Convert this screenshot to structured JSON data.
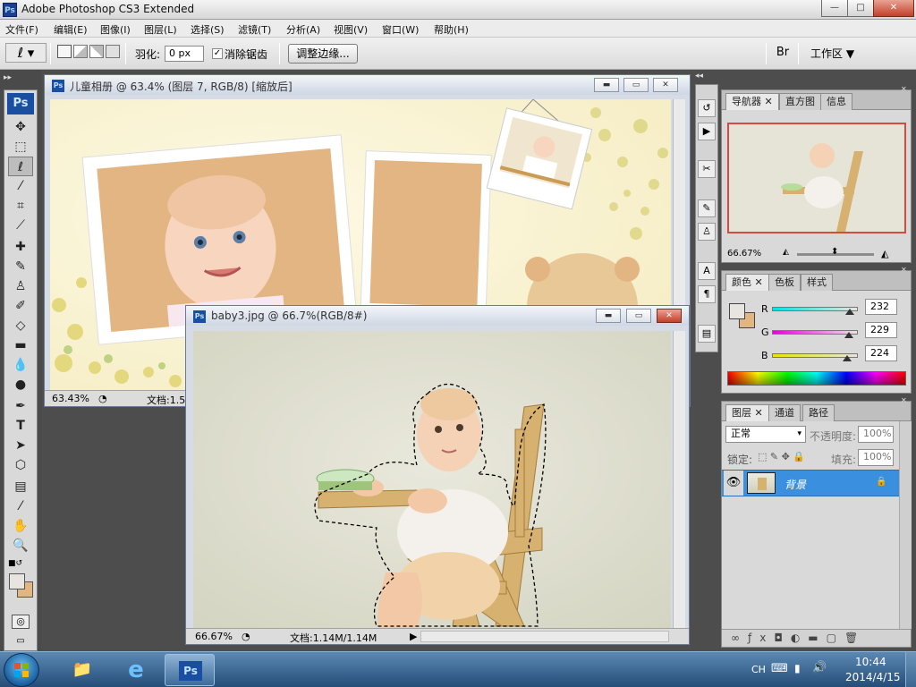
{
  "app": {
    "title": "Adobe Photoshop CS3 Extended",
    "icon": "Ps",
    "window_buttons": {
      "minimize": "—",
      "maximize": "□",
      "close": "✕"
    }
  },
  "menu": [
    "文件(F)",
    "编辑(E)",
    "图像(I)",
    "图层(L)",
    "选择(S)",
    "滤镜(T)",
    "分析(A)",
    "视图(V)",
    "窗口(W)",
    "帮助(H)"
  ],
  "options": {
    "feather_label": "羽化:",
    "feather_value": "0 px",
    "antialias_label": "消除锯齿",
    "antialias_checked": "✓",
    "refine_edge": "调整边缘...",
    "workspace": "工作区 ▼"
  },
  "toolbox": {
    "logo": "Ps"
  },
  "doc1": {
    "title": "儿童相册 @ 63.4% (图层 7, RGB/8) [缩放后]",
    "zoom": "63.43%",
    "doc_info": "文档:1.5"
  },
  "doc2": {
    "title": "baby3.jpg @ 66.7%(RGB/8#)",
    "zoom": "66.67%",
    "doc_info": "文档:1.14M/1.14M"
  },
  "navigator": {
    "tabs": [
      "导航器",
      "直方图",
      "信息"
    ],
    "zoom": "66.67%"
  },
  "color": {
    "tabs": [
      "颜色",
      "色板",
      "样式"
    ],
    "channels": [
      {
        "name": "R",
        "value": "232",
        "fill": 0.91
      },
      {
        "name": "G",
        "value": "229",
        "fill": 0.9
      },
      {
        "name": "B",
        "value": "224",
        "fill": 0.88
      }
    ],
    "fg": "#e8e5e0",
    "bg": "#e3b582"
  },
  "layers": {
    "tabs": [
      "图层",
      "通道",
      "路径"
    ],
    "blend_mode": "正常",
    "opacity_label": "不透明度:",
    "opacity_value": "100%",
    "lock_label": "锁定:",
    "fill_label": "填充:",
    "fill_value": "100%",
    "layer_name": "背景"
  },
  "taskbar": {
    "ime": "CH",
    "time": "10:44",
    "date": "2014/4/15",
    "ps_label": "Ps"
  }
}
